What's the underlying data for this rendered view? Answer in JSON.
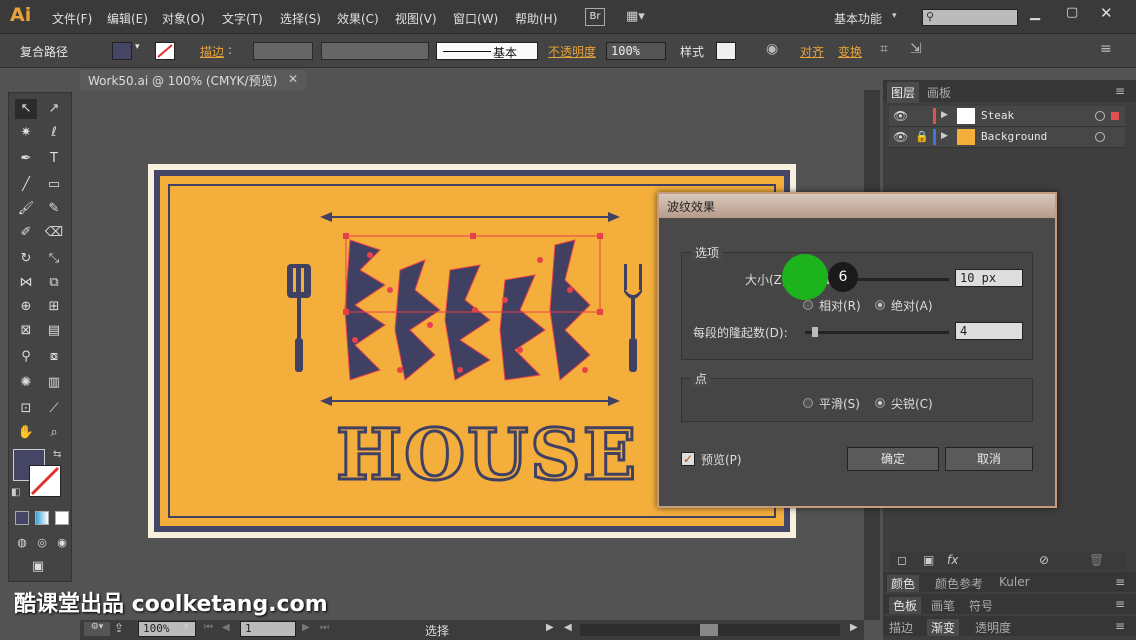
{
  "menubar": {
    "logo": "Ai",
    "items": [
      "文件(F)",
      "编辑(E)",
      "对象(O)",
      "文字(T)",
      "选择(S)",
      "效果(C)",
      "视图(V)",
      "窗口(W)",
      "帮助(H)"
    ],
    "br": "Br",
    "workspace": "基本功能",
    "search_placeholder": ""
  },
  "ctrlbar": {
    "object_type": "复合路径",
    "stroke_label": "描边",
    "stroke_style": "基本",
    "opacity_label": "不透明度",
    "opacity_value": "100%",
    "style_label": "样式",
    "align_label": "对齐",
    "transform_label": "变换",
    "fill_color": "#454566",
    "stroke_color": "#ffffff"
  },
  "document": {
    "tab_title": "Work50.ai @ 100% (CMYK/预览)",
    "zoom": "100%",
    "artboard_num": "1",
    "status_tool": "选择"
  },
  "artwork": {
    "headline": "HOUSE",
    "colors": {
      "orange": "#f3ae3c",
      "navy": "#454566",
      "cream": "#f6f0dc",
      "selection": "#e8404b"
    }
  },
  "layers_panel": {
    "tabs": [
      "图层",
      "画板"
    ],
    "layers": [
      {
        "name": "Steak",
        "color": "#e05050"
      },
      {
        "name": "Background",
        "color": "#3a78d8"
      }
    ]
  },
  "panels": {
    "color_tabs": [
      "颜色",
      "颜色参考",
      "Kuler"
    ],
    "swatch_tabs": [
      "色板",
      "画笔",
      "符号"
    ],
    "stroke_tabs": [
      "描边",
      "渐变",
      "透明度"
    ]
  },
  "dialog": {
    "title": "波纹效果",
    "options_group": "选项",
    "size_label": "大小(Z):",
    "size_value": "10 px",
    "size_slider_fraction": 0.15,
    "relative_label": "相对(R)",
    "absolute_label": "绝对(A)",
    "ridges_label": "每段的隆起数(D):",
    "ridges_value": "4",
    "ridges_slider_fraction": 0.05,
    "points_group": "点",
    "smooth_label": "平滑(S)",
    "corner_label": "尖锐(C)",
    "preview_label": "预览(P)",
    "ok_label": "确定",
    "cancel_label": "取消"
  },
  "overlay": {
    "step_number": "6",
    "watermark": "酷课堂出品 coolketang.com"
  }
}
